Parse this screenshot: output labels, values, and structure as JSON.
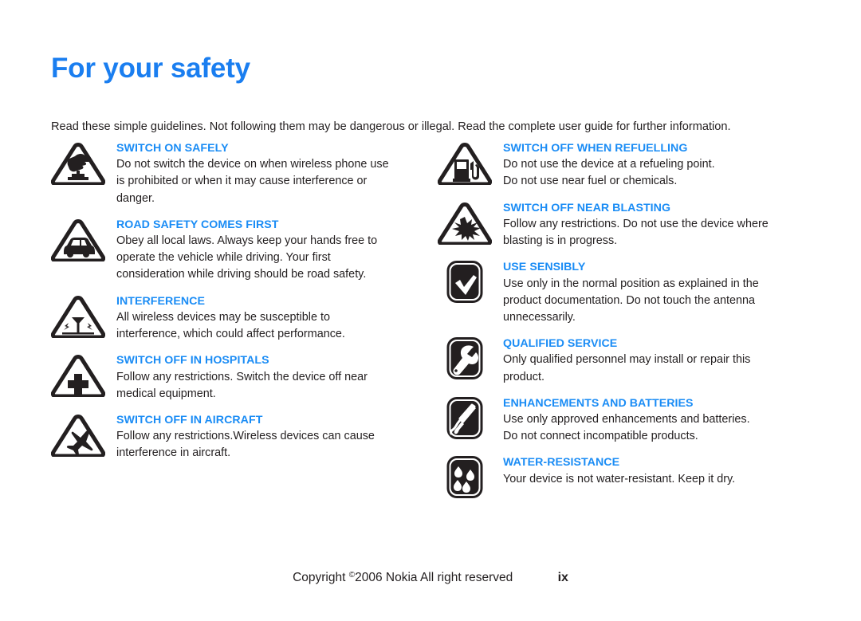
{
  "document": {
    "title": "For your safety",
    "intro": "Read these simple guidelines. Not following them may be dangerous or illegal. Read the complete user guide for further information.",
    "title_color": "#1a7ef0",
    "heading_color": "#1a8cf5",
    "body_color": "#231f20"
  },
  "left_column": [
    {
      "icon": "warning-triangle-switch-on-icon",
      "title": "SWITCH ON SAFELY",
      "lines": [
        "Do not switch the device on when wireless phone use",
        "is prohibited or when it may cause interference or",
        "danger."
      ]
    },
    {
      "icon": "warning-triangle-car-icon",
      "title": "ROAD SAFETY COMES FIRST",
      "lines": [
        "Obey all local laws. Always keep your hands free to",
        "operate the vehicle while driving. Your first",
        "consideration while driving should be road safety."
      ]
    },
    {
      "icon": "warning-triangle-interference-icon",
      "title": "INTERFERENCE",
      "lines": [
        "All wireless devices may be susceptible to",
        "interference, which could affect performance."
      ]
    },
    {
      "icon": "warning-triangle-hospital-icon",
      "title": "SWITCH OFF IN HOSPITALS",
      "lines": [
        "Follow any restrictions. Switch the device off near",
        "medical equipment."
      ]
    },
    {
      "icon": "warning-triangle-aircraft-icon",
      "title": "SWITCH OFF IN AIRCRAFT",
      "lines": [
        "Follow any restrictions.Wireless devices can cause",
        "interference in aircraft."
      ]
    }
  ],
  "right_column": [
    {
      "icon": "warning-triangle-fuel-pump-icon",
      "title": "SWITCH OFF WHEN REFUELLING",
      "lines": [
        "Do not use the device at a refueling point.",
        "Do not use near fuel or chemicals."
      ]
    },
    {
      "icon": "warning-triangle-blasting-icon",
      "title": "SWITCH OFF NEAR BLASTING",
      "lines": [
        "Follow any restrictions. Do not use the device where",
        "blasting is in progress."
      ]
    },
    {
      "icon": "rounded-square-checkmark-icon",
      "title": "USE SENSIBLY",
      "lines": [
        "Use only in the normal position as explained in the",
        "product documentation. Do not touch the antenna",
        "unnecessarily."
      ]
    },
    {
      "icon": "rounded-square-wrench-icon",
      "title": "QUALIFIED SERVICE",
      "lines": [
        "Only qualified personnel may install or repair this",
        "product."
      ]
    },
    {
      "icon": "rounded-square-stylus-icon",
      "title": "ENHANCEMENTS AND BATTERIES",
      "lines": [
        "Use only approved enhancements and batteries.",
        "Do not connect incompatible products."
      ]
    },
    {
      "icon": "rounded-square-water-drops-icon",
      "title": "WATER-RESISTANCE",
      "lines": [
        "Your device is not water-resistant. Keep it dry."
      ]
    }
  ],
  "footer": {
    "copyright_prefix": "Copyright ",
    "copyright_symbol": "©",
    "copyright_rest": "2006 Nokia All right reserved",
    "page_number": "ix"
  }
}
